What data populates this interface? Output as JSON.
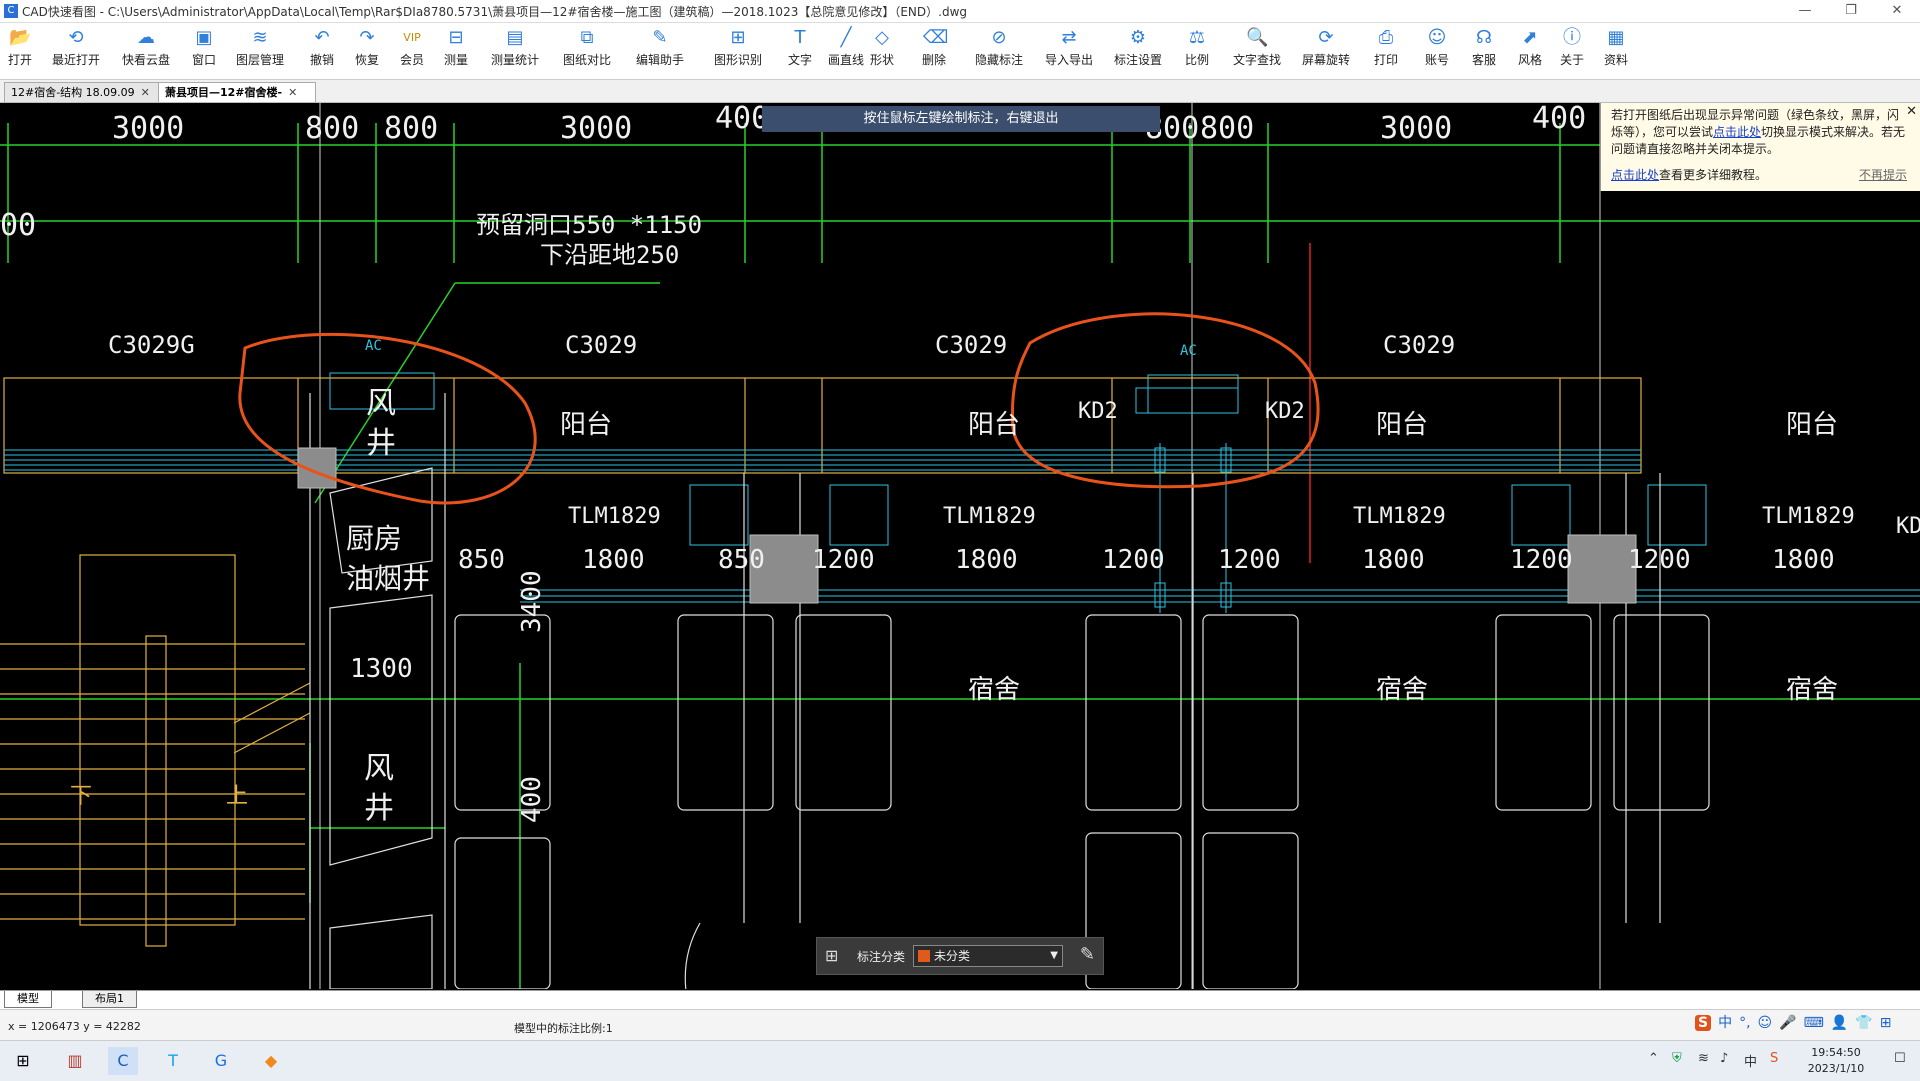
{
  "window": {
    "app_icon": "C",
    "title": "CAD快速看图 - C:\\Users\\Administrator\\AppData\\Local\\Temp\\Rar$DIa8780.5731\\萧县项目—12#宿舍楼—施工图（建筑稿）—2018.1023【总院意见修改】（END）.dwg",
    "minimize": "—",
    "restore": "❐",
    "close": "✕"
  },
  "toolbar": [
    {
      "label": "打开",
      "icon": "folder-icon",
      "glyph": "📂"
    },
    {
      "label": "最近打开",
      "icon": "history-icon",
      "glyph": "⟲"
    },
    {
      "label": "快看云盘",
      "icon": "cloud-icon",
      "glyph": "☁"
    },
    {
      "label": "窗口",
      "icon": "window-icon",
      "glyph": "▣"
    },
    {
      "label": "图层管理",
      "icon": "layers-icon",
      "glyph": "≋"
    },
    {
      "label": "撤销",
      "icon": "undo-icon",
      "glyph": "↶"
    },
    {
      "label": "恢复",
      "icon": "redo-icon",
      "glyph": "↷"
    },
    {
      "label": "会员",
      "icon": "vip-icon",
      "glyph": "VIP"
    },
    {
      "label": "测量",
      "icon": "measure-icon",
      "glyph": "⊟"
    },
    {
      "label": "测量统计",
      "icon": "measure-stats-icon",
      "glyph": "▤"
    },
    {
      "label": "图纸对比",
      "icon": "compare-icon",
      "glyph": "⧉"
    },
    {
      "label": "编辑助手",
      "icon": "edit-assistant-icon",
      "glyph": "✎"
    },
    {
      "label": "图形识别",
      "icon": "shape-recognize-icon",
      "glyph": "⊞"
    },
    {
      "label": "文字",
      "icon": "text-icon",
      "glyph": "T"
    },
    {
      "label": "画直线",
      "icon": "line-icon",
      "glyph": "╱"
    },
    {
      "label": "形状",
      "icon": "shape-icon",
      "glyph": "◇"
    },
    {
      "label": "删除",
      "icon": "eraser-icon",
      "glyph": "⌫"
    },
    {
      "label": "隐藏标注",
      "icon": "hide-annotation-icon",
      "glyph": "⊘"
    },
    {
      "label": "导入导出",
      "icon": "import-export-icon",
      "glyph": "⇄"
    },
    {
      "label": "标注设置",
      "icon": "annotation-settings-icon",
      "glyph": "⚙"
    },
    {
      "label": "比例",
      "icon": "scale-icon",
      "glyph": "⚖"
    },
    {
      "label": "文字查找",
      "icon": "text-search-icon",
      "glyph": "🔍"
    },
    {
      "label": "屏幕旋转",
      "icon": "rotate-screen-icon",
      "glyph": "⟳"
    },
    {
      "label": "打印",
      "icon": "print-icon",
      "glyph": "⎙"
    },
    {
      "label": "账号",
      "icon": "account-icon",
      "glyph": "☺"
    },
    {
      "label": "客服",
      "icon": "headset-icon",
      "glyph": "☊"
    },
    {
      "label": "风格",
      "icon": "style-icon",
      "glyph": "⬈"
    },
    {
      "label": "关于",
      "icon": "info-icon",
      "glyph": "ⓘ"
    },
    {
      "label": "资料",
      "icon": "docs-icon",
      "glyph": "▦"
    }
  ],
  "tabs": [
    {
      "label": "12#宿舍-结构 18.09.09",
      "close": "✕"
    },
    {
      "label": "萧县项目—12#宿舍楼-",
      "close": "✕"
    }
  ],
  "hint": "按住鼠标左键绘制标注，右键退出",
  "notice": {
    "text1": "若打开图纸后出现显示异常问题（绿色条纹，黑屏，闪烁等），您可以尝试",
    "link1": "点击此处",
    "text2": "切换显示模式来解决。若无问题请直接忽略并关闭本提示。",
    "link2": "点击此处",
    "text3": "查看更多详细教程。",
    "nomore": "不再提示",
    "close": "✕"
  },
  "drawing": {
    "dims_top": [
      "3000",
      "800",
      "800",
      "3000",
      "400",
      "3000",
      "800",
      "800",
      "3000",
      "400"
    ],
    "left_dim": "00",
    "note1": "预留洞口550 *1150",
    "note2": "下沿距地250",
    "windows": [
      "C3029G",
      "C3029",
      "C3029",
      "C3029"
    ],
    "ac_label": "AC",
    "kd": [
      "KD2",
      "KD2"
    ],
    "balcony": [
      "阳台",
      "阳台",
      "阳台",
      "阳台"
    ],
    "shaft1": [
      "风",
      "井"
    ],
    "shaft2": [
      "厨房",
      "油烟井"
    ],
    "shaft3": [
      "风",
      "井"
    ],
    "door": [
      "TLM1829",
      "TLM1829",
      "TLM1829",
      "TLM1829"
    ],
    "kd_edge": "KD",
    "dims_mid": [
      "850",
      "1800",
      "850",
      "1200",
      "1800",
      "1200",
      "1200",
      "1800",
      "1200",
      "1200",
      "1800"
    ],
    "dim_1300": "1300",
    "dim_3400": "3400",
    "dim_400": "400",
    "dorm": [
      "宿舍",
      "宿舍",
      "宿舍"
    ],
    "stair_down": "下",
    "stair_up": "上"
  },
  "annotation_bar": {
    "label": "标注分类",
    "selected": "未分类",
    "swatch_color": "#e05a1c"
  },
  "layout_tabs": [
    "模型",
    "布局1"
  ],
  "status": {
    "coords": "x = 1206473  y = 42282",
    "scale_text": "模型中的标注比例:1"
  },
  "ime": [
    "中",
    "°,",
    "☺",
    "🎤",
    "⌨",
    "👤",
    "👕",
    "⊞"
  ],
  "taskbar": {
    "clock_time": "19:54:50",
    "clock_date": "2023/1/10",
    "tray_ime": "中"
  }
}
